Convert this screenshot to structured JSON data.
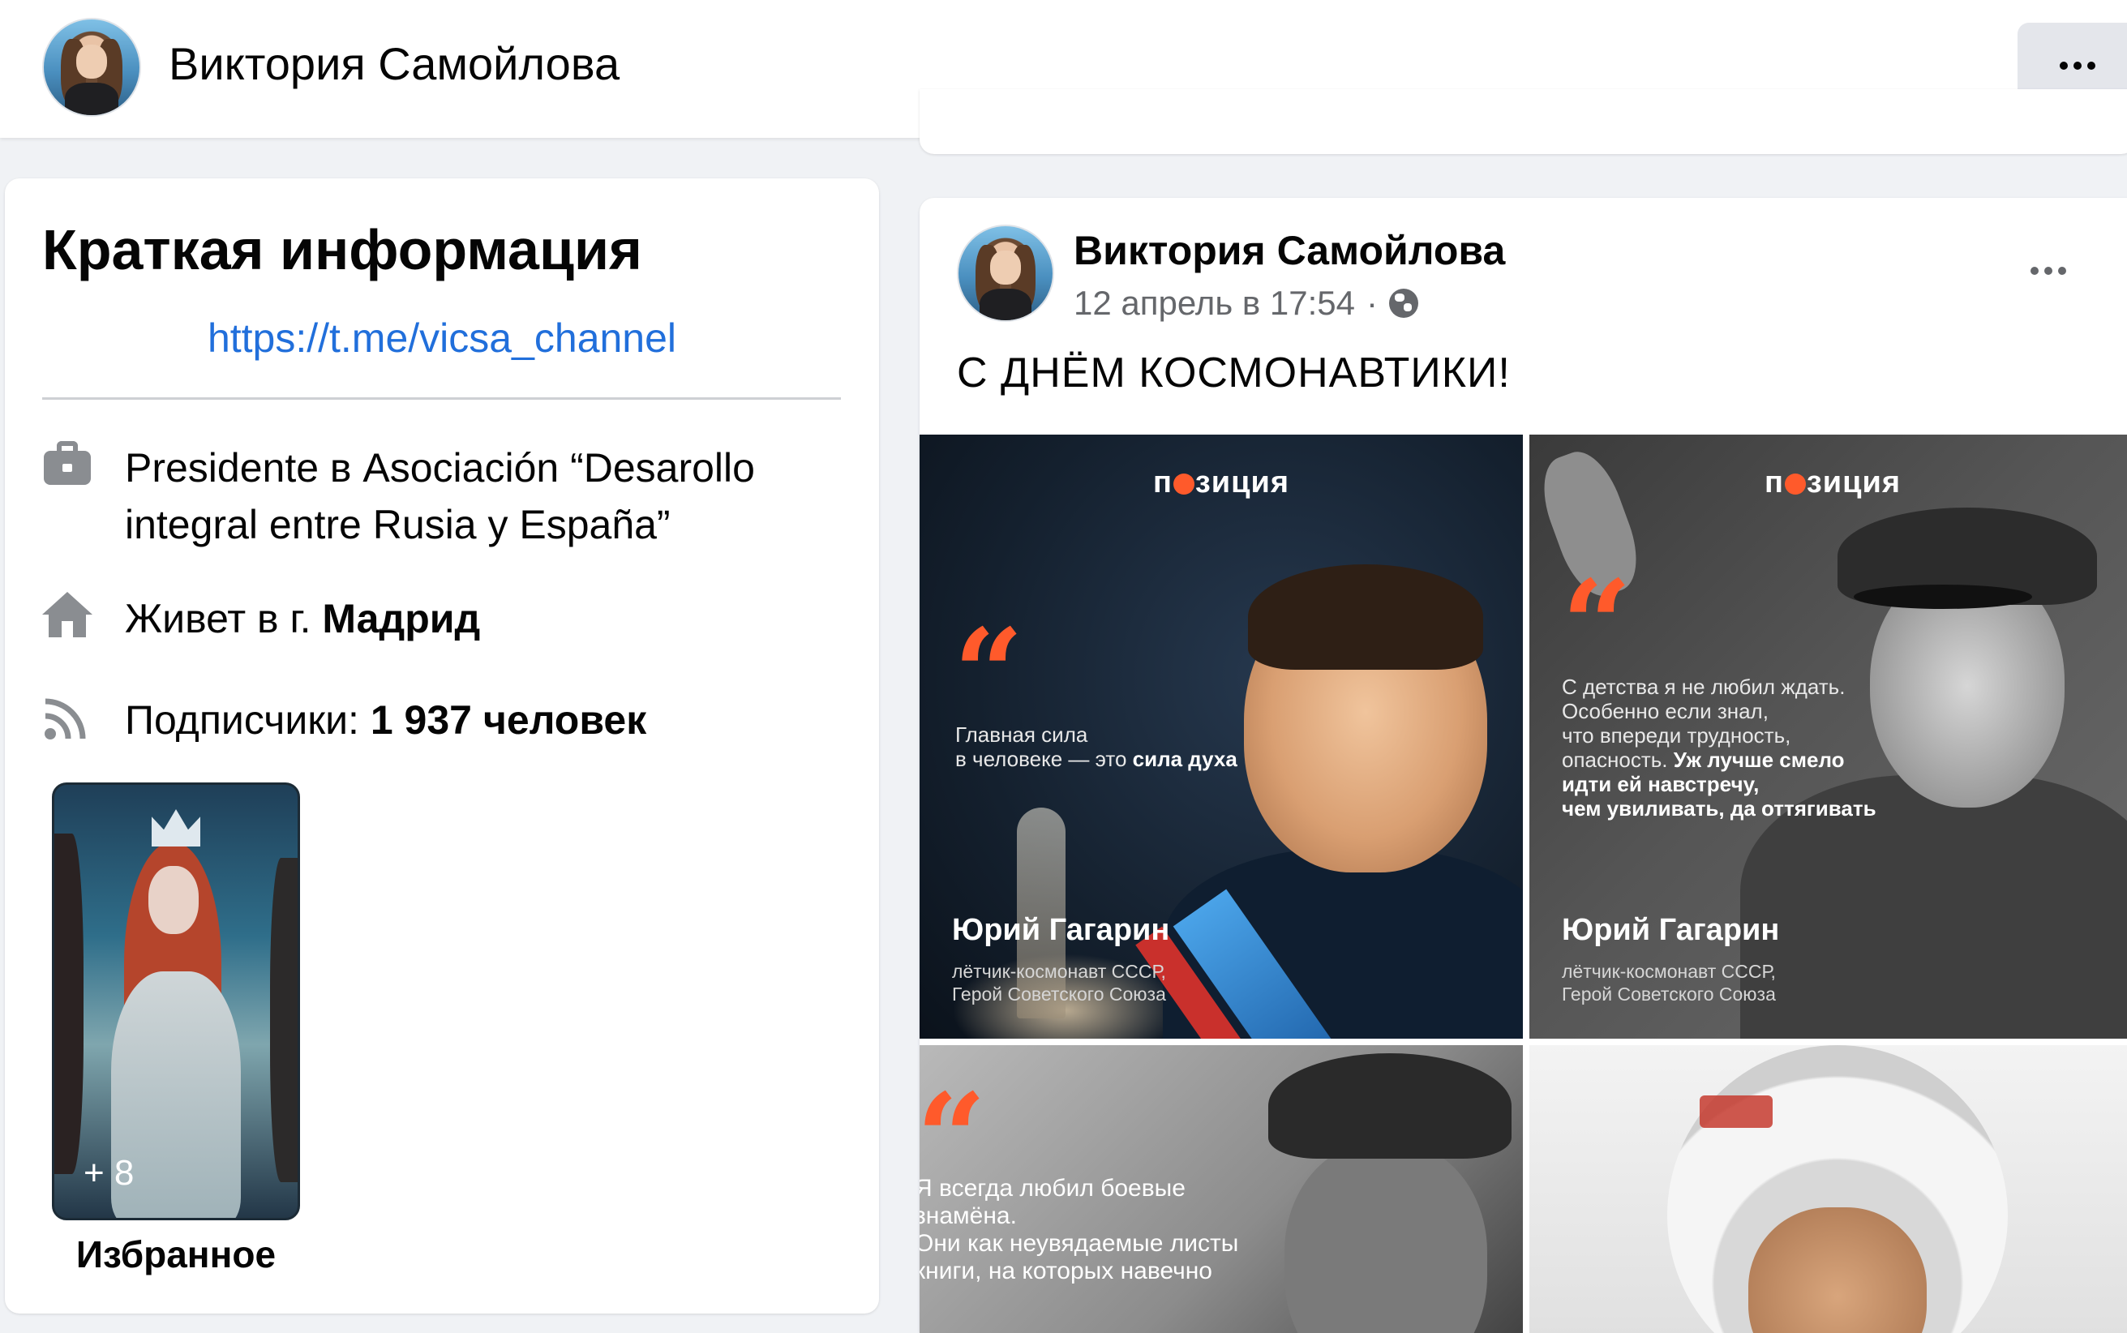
{
  "header": {
    "name": "Виктория Самойлова",
    "menu_icon": "more-dots-icon"
  },
  "intro": {
    "title": "Краткая информация",
    "link": "https://t.me/vicsa_channel",
    "work": {
      "icon": "briefcase-icon",
      "line1": "Presidente в Asociación “Desarollo",
      "line2": "integral entre Rusia y España”"
    },
    "home": {
      "icon": "home-icon",
      "prefix": "Живет в г. ",
      "city": "Мадрид"
    },
    "followers": {
      "icon": "rss-icon",
      "prefix": "Подписчики: ",
      "count": "1 937 человек"
    },
    "featured": {
      "count": "+ 8",
      "label": "Избранное"
    }
  },
  "post": {
    "author": "Виктория Самойлова",
    "date": "12 апрель в 17:54",
    "separator": "·",
    "privacy_icon": "globe-icon",
    "text": "С ДНЁМ КОСМОНАВТИКИ!",
    "images": [
      {
        "brand_pre": "п",
        "brand_post": "зиция",
        "quote_line1": "Главная сила",
        "quote_line2_pre": "в человеке — это ",
        "quote_line2_bold": "сила духа",
        "name": "Юрий Гагарин",
        "role_line1": "лётчик-космонавт СССР,",
        "role_line2": "Герой Советского Союза"
      },
      {
        "brand_pre": "п",
        "brand_post": "зиция",
        "quote_line1": "С детства я не любил ждать.",
        "quote_line2": "Особенно если знал,",
        "quote_line3": "что впереди трудность,",
        "quote_line4_pre": "опасность. ",
        "quote_line4_bold": "Уж лучше смело",
        "quote_line5_bold": "идти ей навстречу,",
        "quote_line6_bold": "чем увиливать, да оттягивать",
        "name": "Юрий Гагарин",
        "role_line1": "лётчик-космонавт СССР,",
        "role_line2": "Герой Советского Союза"
      },
      {
        "quote_line1": "Я всегда любил боевые",
        "quote_line2": "знамёна.",
        "quote_line3": "Они как неувядаемые листы",
        "quote_line4": "книги, на которых навечно"
      },
      {}
    ]
  }
}
